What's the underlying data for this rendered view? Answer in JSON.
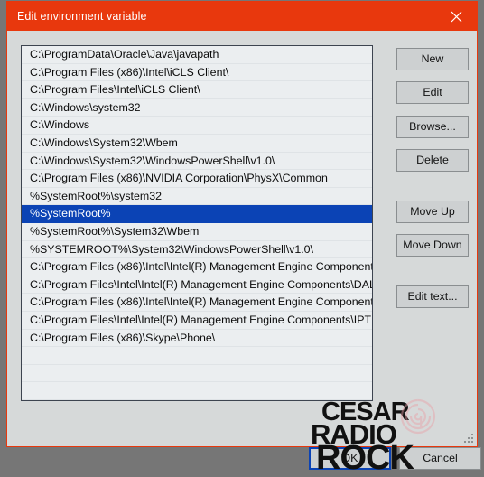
{
  "window": {
    "title": "Edit environment variable",
    "close_icon": "close-icon",
    "titlebar_color": "#e8380d",
    "background_color": "#d6d9d9"
  },
  "list": {
    "selected_index": 9,
    "selection_color": "#0b43b5",
    "items": [
      "C:\\ProgramData\\Oracle\\Java\\javapath",
      "C:\\Program Files (x86)\\Intel\\iCLS Client\\",
      "C:\\Program Files\\Intel\\iCLS Client\\",
      "C:\\Windows\\system32",
      "C:\\Windows",
      "C:\\Windows\\System32\\Wbem",
      "C:\\Windows\\System32\\WindowsPowerShell\\v1.0\\",
      "C:\\Program Files (x86)\\NVIDIA Corporation\\PhysX\\Common",
      "%SystemRoot%\\system32",
      "%SystemRoot%",
      "%SystemRoot%\\System32\\Wbem",
      "%SYSTEMROOT%\\System32\\WindowsPowerShell\\v1.0\\",
      "C:\\Program Files (x86)\\Intel\\Intel(R) Management Engine Component...",
      "C:\\Program Files\\Intel\\Intel(R) Management Engine Components\\DAL",
      "C:\\Program Files (x86)\\Intel\\Intel(R) Management Engine Component...",
      "C:\\Program Files\\Intel\\Intel(R) Management Engine Components\\IPT",
      "C:\\Program Files (x86)\\Skype\\Phone\\"
    ],
    "empty_row_count": 3
  },
  "side_buttons": {
    "new": "New",
    "edit": "Edit",
    "browse": "Browse...",
    "delete": "Delete",
    "move_up": "Move Up",
    "move_down": "Move Down",
    "edit_text": "Edit text..."
  },
  "footer": {
    "ok": "OK",
    "cancel": "Cancel",
    "focused_button": "OK"
  },
  "watermark": {
    "line1": "CESAR",
    "line2": "RADIO",
    "line3": "ROCK",
    "logo_icon": "spiral-logo-icon",
    "logo_color": "#e8a0a8"
  }
}
